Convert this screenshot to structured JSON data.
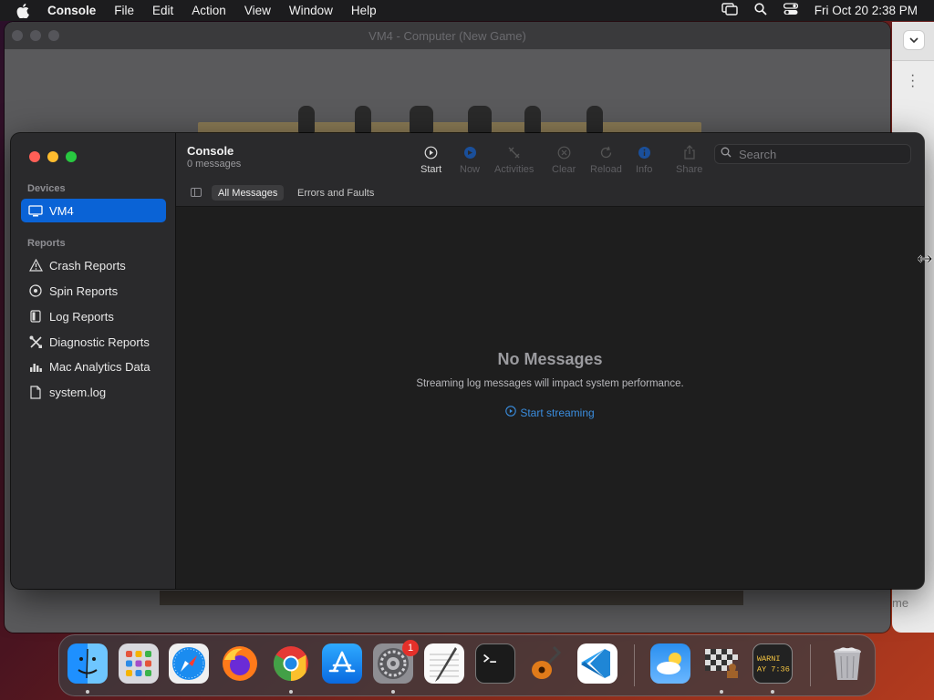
{
  "menubar": {
    "app_name": "Console",
    "menus": [
      "File",
      "Edit",
      "Action",
      "View",
      "Window",
      "Help"
    ],
    "clock": "Fri Oct 20  2:38 PM"
  },
  "background_window": {
    "title": "VM4 - Computer  (New Game)"
  },
  "right_window": {
    "partial_text": "me"
  },
  "console": {
    "title": "Console",
    "subtitle": "0 messages",
    "sidebar": {
      "devices_label": "Devices",
      "device": "VM4",
      "reports_label": "Reports",
      "reports": [
        {
          "label": "Crash Reports",
          "icon": "warning-icon"
        },
        {
          "label": "Spin Reports",
          "icon": "spin-icon"
        },
        {
          "label": "Log Reports",
          "icon": "log-icon"
        },
        {
          "label": "Diagnostic Reports",
          "icon": "tools-icon"
        },
        {
          "label": "Mac Analytics Data",
          "icon": "chart-icon"
        },
        {
          "label": "system.log",
          "icon": "document-icon"
        }
      ]
    },
    "toolbar": {
      "start": "Start",
      "now": "Now",
      "activities": "Activities",
      "clear": "Clear",
      "reload": "Reload",
      "info": "Info",
      "share": "Share"
    },
    "search": {
      "placeholder": "Search"
    },
    "filters": {
      "all": "All Messages",
      "errors": "Errors and Faults"
    },
    "empty": {
      "heading": "No Messages",
      "message": "Streaming log messages will impact system performance.",
      "action": "Start streaming"
    }
  },
  "dock": {
    "apps": [
      "Finder",
      "Launchpad",
      "Safari",
      "Firefox",
      "Chrome",
      "App Store",
      "System Settings",
      "TextEdit",
      "Terminal",
      "GarageBand",
      "Visual Studio Code",
      "Weather",
      "Chess",
      "Console",
      "Trash"
    ],
    "settings_badge": "1",
    "console_icon_text": "WARNI\nAY 7:36"
  },
  "colors": {
    "accent": "#0a63d6",
    "link": "#3a8dde"
  }
}
